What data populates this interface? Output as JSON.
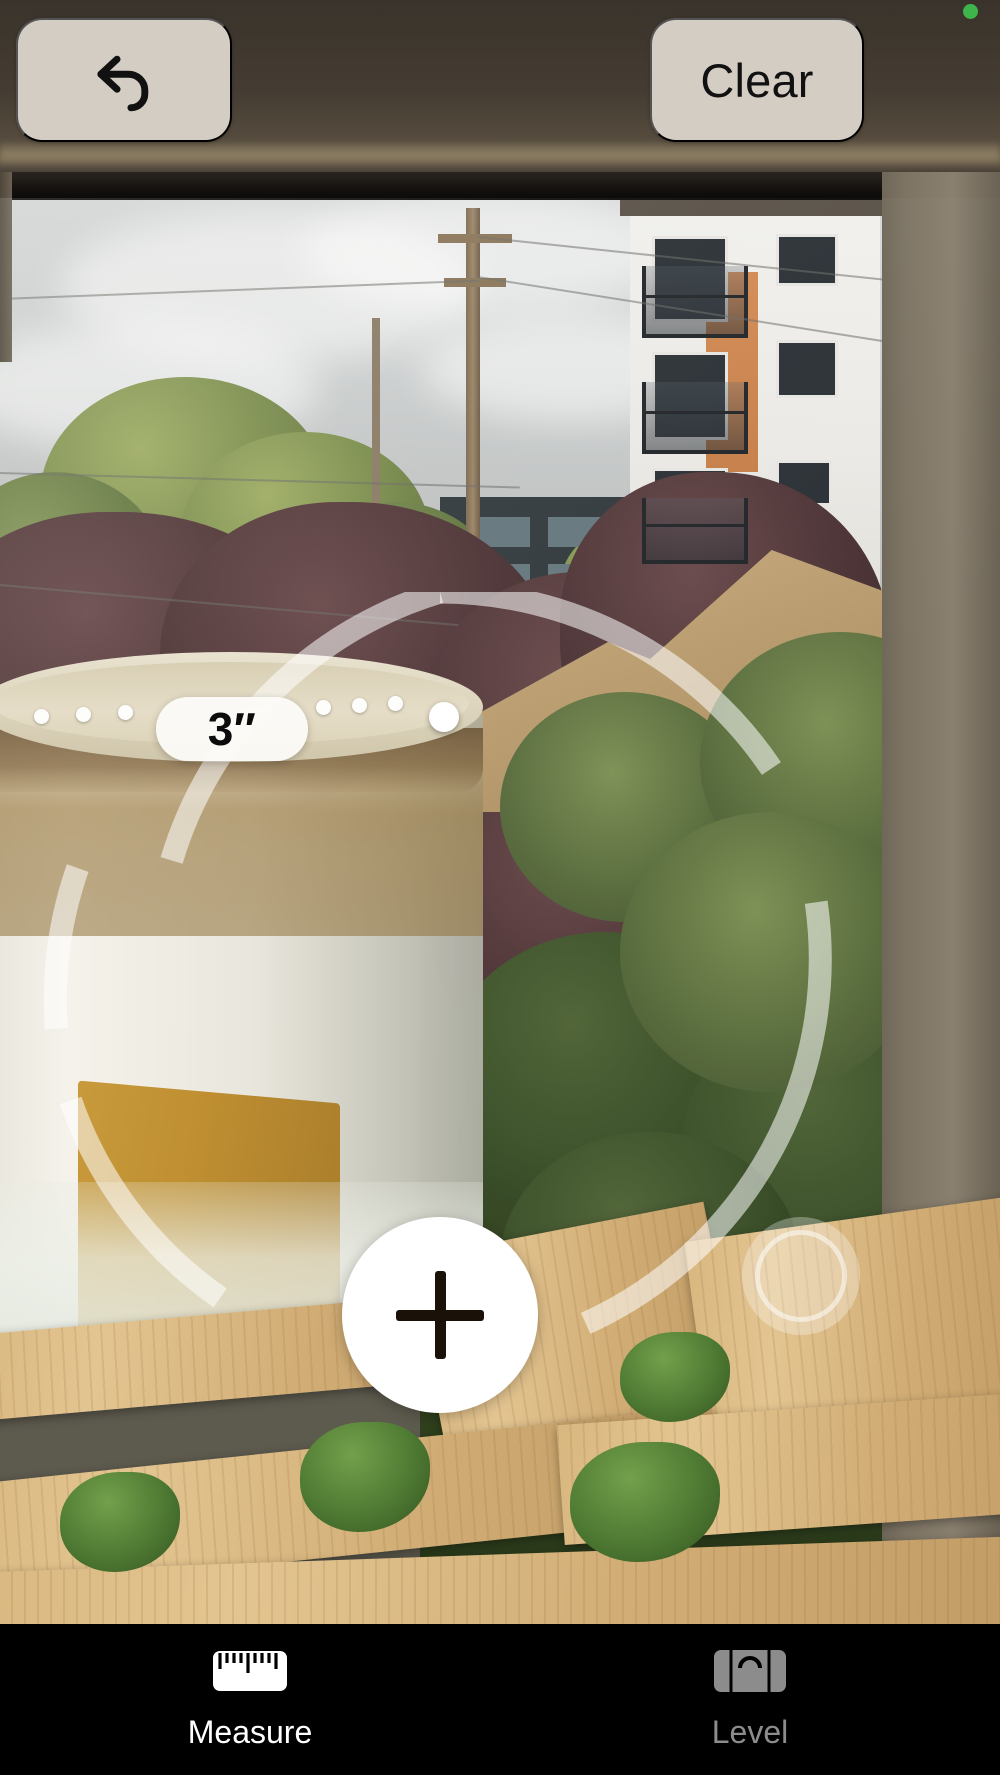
{
  "app": {
    "name": "Measure",
    "accent_white": "#ffffff",
    "tabbar_background": "#000000",
    "toolbar_button_color": "#d4cdc4"
  },
  "status": {
    "camera_indicator": "green-recording-dot",
    "camera_indicator_color": "#3eb54a"
  },
  "toolbar": {
    "undo_icon": "undo-arrow-icon",
    "undo_label": "",
    "clear_label": "Clear"
  },
  "ar": {
    "reticle_icon": "focus-reticle-icon",
    "reticle_color": "rgba(255,255,255,0.55)",
    "measurement": {
      "value": "3″",
      "unit": "inches",
      "number": 3,
      "line_style": "dotted",
      "dot_count": 7,
      "endpoint_icon": "measurement-endpoint-dot"
    }
  },
  "controls": {
    "add_point_icon": "plus-icon",
    "add_point_label": "",
    "shutter_icon": "shutter-ring-icon",
    "shutter_label": ""
  },
  "tabs": [
    {
      "id": "measure",
      "label": "Measure",
      "icon": "ruler-icon",
      "active": true,
      "color": "#ffffff"
    },
    {
      "id": "level",
      "label": "Level",
      "icon": "bubble-level-icon",
      "active": false,
      "color": "#8c8c8c"
    }
  ]
}
